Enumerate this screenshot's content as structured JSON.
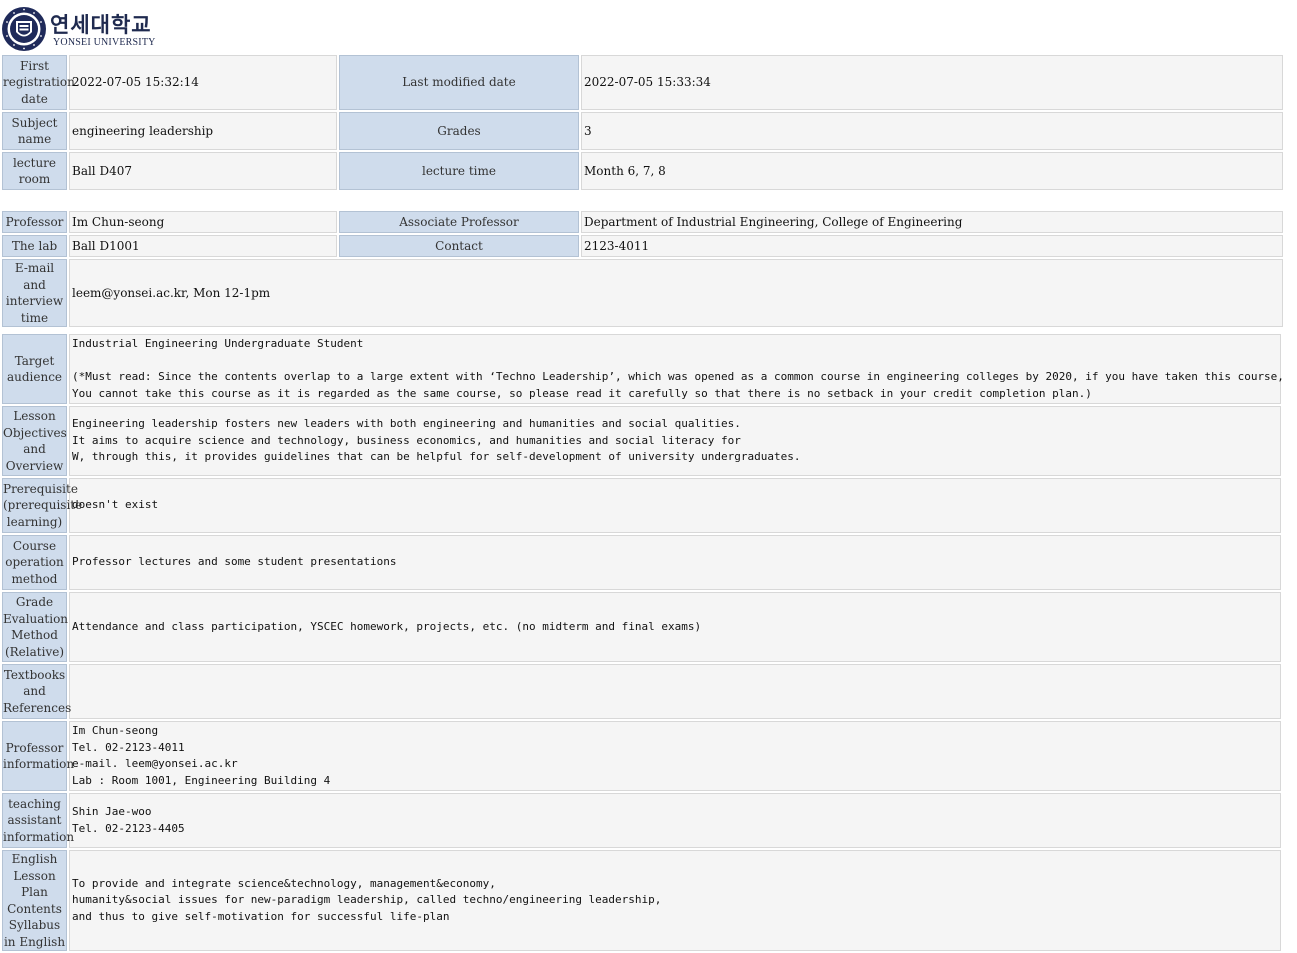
{
  "header": {
    "logo": "yonsei-emblem",
    "name_kr": "연세대학교",
    "name_en": "YONSEI UNIVERSITY"
  },
  "basic": {
    "first_reg_label": "First registration date",
    "first_reg_value": "2022-07-05 15:32:14",
    "last_mod_label": "Last modified date",
    "last_mod_value": "2022-07-05 15:33:34",
    "subject_label": "Subject name",
    "subject_value": "engineering leadership",
    "grades_label": "Grades",
    "grades_value": "3",
    "room_label": "lecture room",
    "room_value": "Ball D407",
    "time_label": "lecture time",
    "time_value": "Month 6, 7, 8"
  },
  "professor": {
    "prof_label": "Professor",
    "prof_value": "Im Chun-seong",
    "assoc_label": "Associate Professor",
    "assoc_value": "Department of Industrial Engineering, College of Engineering",
    "lab_label": "The lab",
    "lab_value": "Ball D1001",
    "contact_label": "Contact",
    "contact_value": "2123-4011",
    "email_label": "E-mail and interview time",
    "email_value": "leem@yonsei.ac.kr, Mon 12-1pm"
  },
  "syllabus": {
    "target_label": "Target audience",
    "target_value": "Industrial Engineering Undergraduate Student\n\n(*Must read: Since the contents overlap to a large extent with ‘Techno Leadership’, which was opened as a common course in engineering colleges by 2020, if you have taken this course,\nYou cannot take this course as it is regarded as the same course, so please read it carefully so that there is no setback in your credit completion plan.)",
    "objectives_label": "Lesson Objectives and Overview",
    "objectives_value": "Engineering leadership fosters new leaders with both engineering and humanities and social qualities.\nIt aims to acquire science and technology, business economics, and humanities and social literacy for\nW, through this, it provides guidelines that can be helpful for self-development of university undergraduates.",
    "prereq_label": "Prerequisite (prerequisite learning)",
    "prereq_value": "doesn't exist",
    "method_label": "Course operation method",
    "method_value": "Professor lectures and some student presentations",
    "grading_label": "Grade Evaluation Method (Relative)",
    "grading_value": "Attendance and class participation, YSCEC homework, projects, etc. (no midterm and final exams)",
    "textbooks_label": "Textbooks and References",
    "textbooks_value": "",
    "profinfo_label": "Professor information",
    "profinfo_value": "Im Chun-seong\nTel. 02-2123-4011\ne-mail. leem@yonsei.ac.kr\nLab : Room 1001, Engineering Building 4",
    "ta_label": "teaching assistant information",
    "ta_value": "Shin Jae-woo\nTel. 02-2123-4405",
    "english_label": "English Lesson Plan Contents Syllabus in English",
    "english_value": "To provide and integrate science&technology, management&economy,\nhumanity&social issues for new-paradigm leadership, called techno/engineering leadership,\nand thus to give self-motivation for successful life-plan"
  }
}
